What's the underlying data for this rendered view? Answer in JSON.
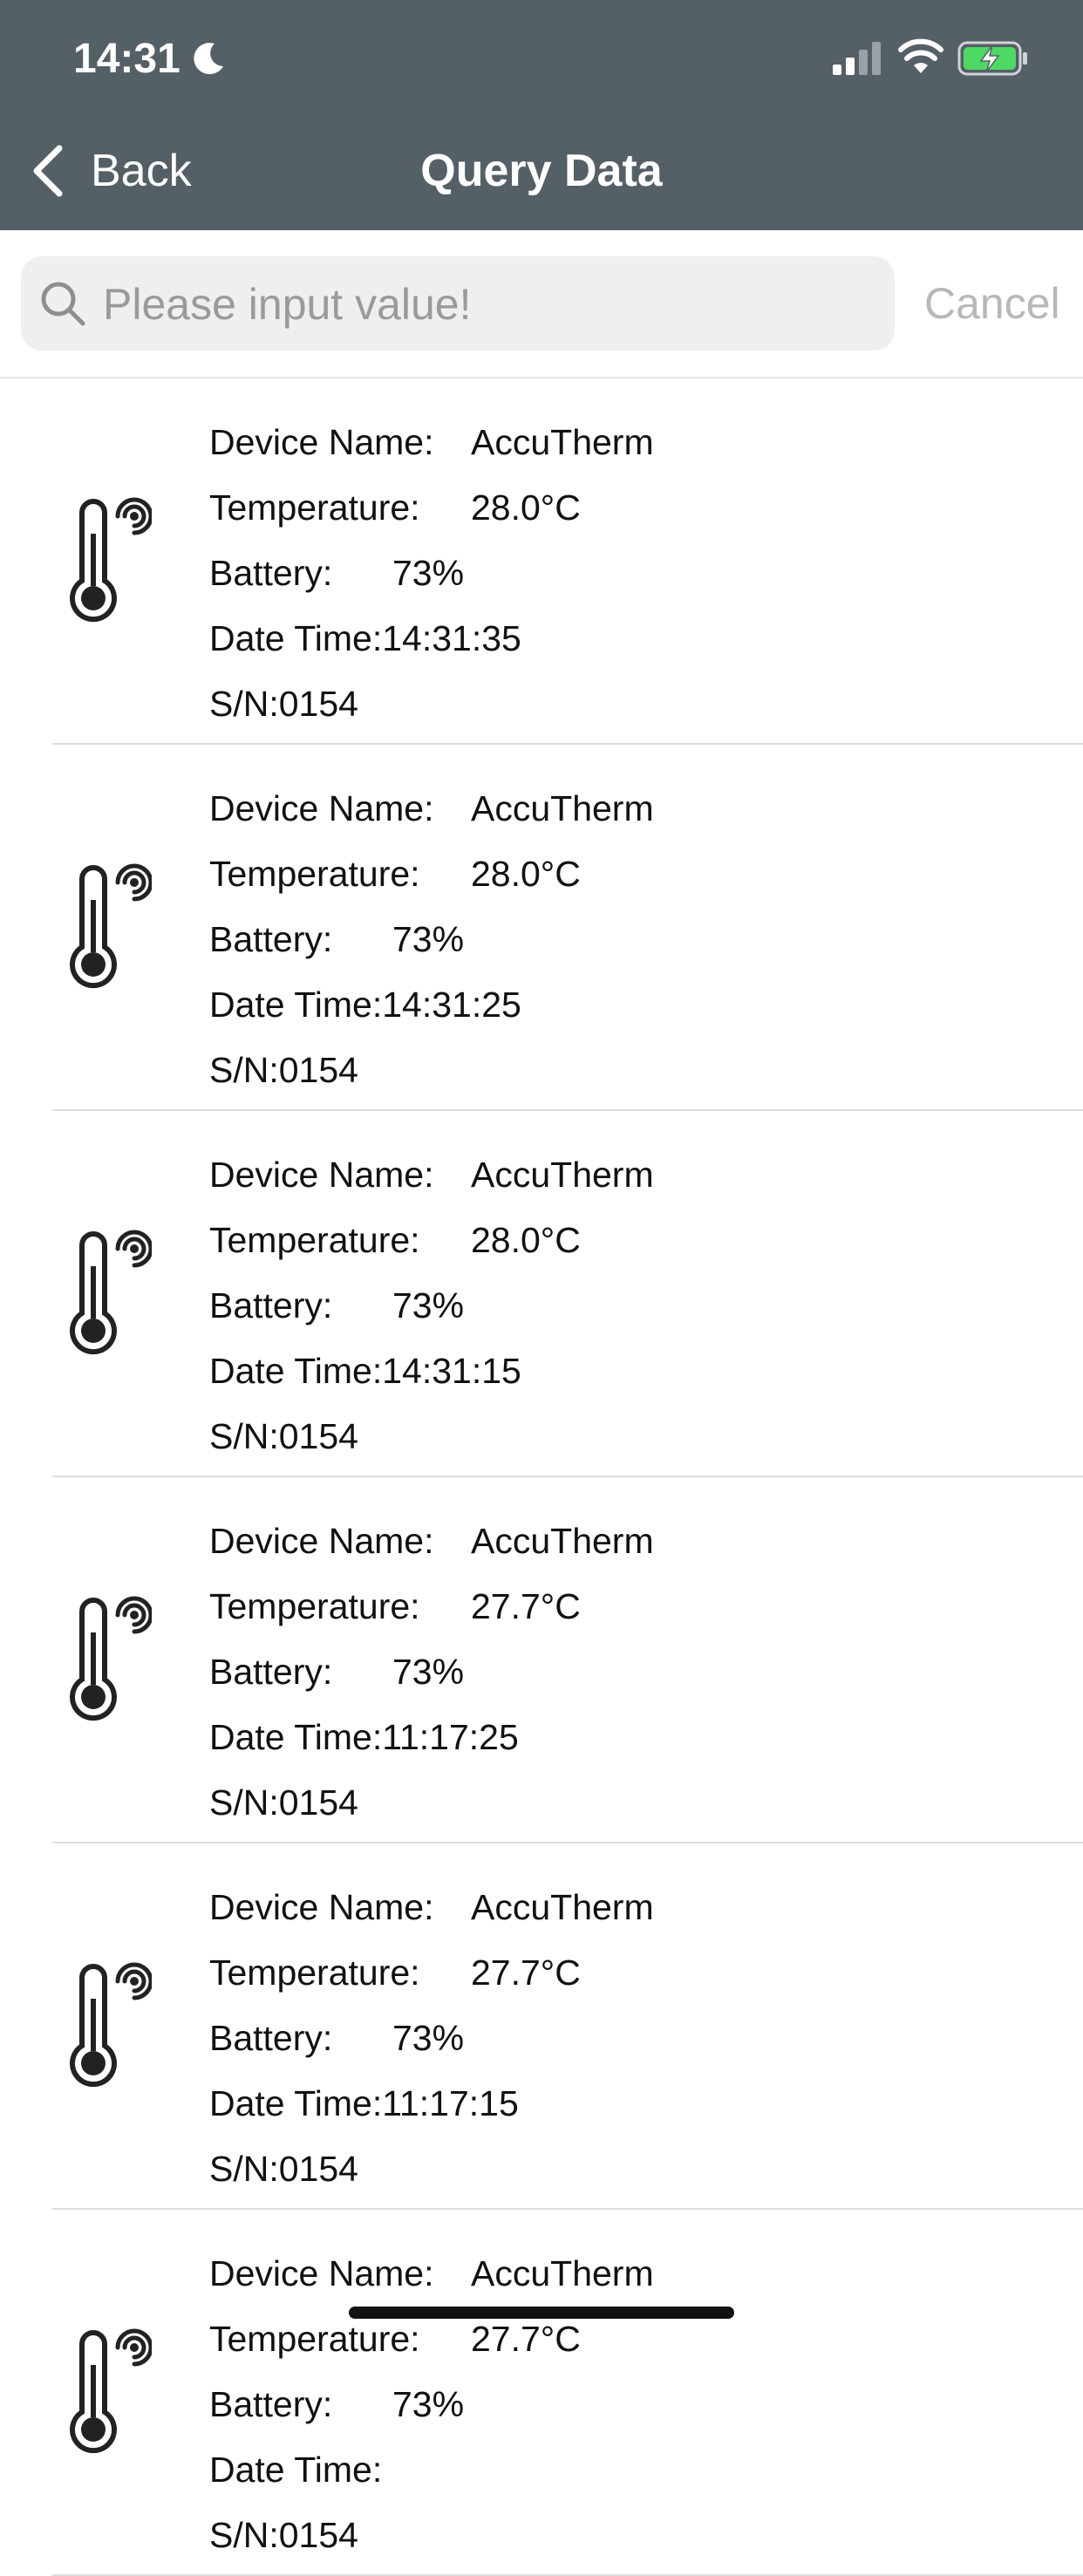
{
  "status_bar": {
    "time": "14:31",
    "moon_icon": "moon-icon",
    "signal_icon": "cellular-signal-icon",
    "wifi_icon": "wifi-icon",
    "battery_icon": "battery-charging-icon",
    "battery_color": "#4cd964"
  },
  "nav": {
    "back_label": "Back",
    "title": "Query Data",
    "background": "#555f66"
  },
  "search": {
    "placeholder": "Please input value!",
    "value": "",
    "cancel_label": "Cancel"
  },
  "labels": {
    "device_name": "Device Name:",
    "temperature": "Temperature:",
    "battery": "Battery:",
    "date_time": "Date Time:",
    "sn_prefix": "S/N:"
  },
  "records": [
    {
      "device_name": "AccuTherm",
      "temperature": "28.0°C",
      "battery": "73%",
      "date_time": "14:31:35",
      "sn": "0154"
    },
    {
      "device_name": "AccuTherm",
      "temperature": "28.0°C",
      "battery": "73%",
      "date_time": "14:31:25",
      "sn": "0154"
    },
    {
      "device_name": "AccuTherm",
      "temperature": "28.0°C",
      "battery": "73%",
      "date_time": "14:31:15",
      "sn": "0154"
    },
    {
      "device_name": "AccuTherm",
      "temperature": "27.7°C",
      "battery": "73%",
      "date_time": "11:17:25",
      "sn": "0154"
    },
    {
      "device_name": "AccuTherm",
      "temperature": "27.7°C",
      "battery": "73%",
      "date_time": "11:17:15",
      "sn": "0154"
    },
    {
      "device_name": "AccuTherm",
      "temperature": "27.7°C",
      "battery": "73%",
      "date_time": "",
      "sn": "0154"
    }
  ]
}
